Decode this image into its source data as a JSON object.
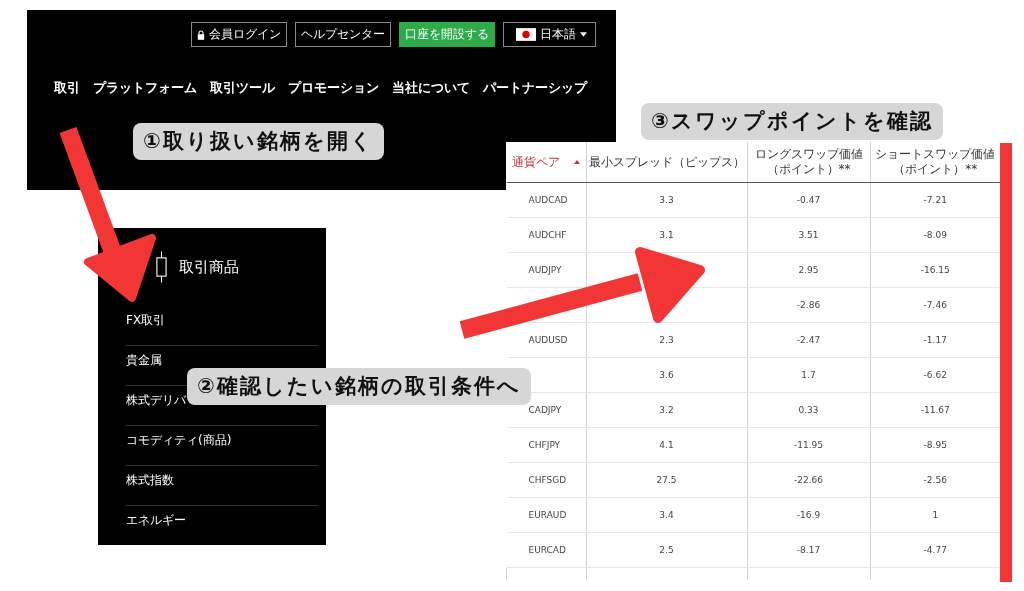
{
  "site": {
    "top_buttons": [
      {
        "kind": "login",
        "label": "会員ログイン"
      },
      {
        "kind": "plain",
        "label": "ヘルプセンター"
      },
      {
        "kind": "primary",
        "label": "口座を開設する"
      },
      {
        "kind": "language",
        "label": "日本語"
      }
    ],
    "menu": [
      "取引",
      "プラットフォーム",
      "取引ツール",
      "プロモーション",
      "当社について",
      "パートナーシップ"
    ]
  },
  "products": {
    "title": "取引商品",
    "items": [
      "FX取引",
      "貴金属",
      "株式デリバ",
      "コモディティ(商品)",
      "株式指数",
      "エネルギー"
    ]
  },
  "table": {
    "columns": [
      {
        "label": "通貨ペア",
        "sorted": true
      },
      {
        "label": "最小スプレッド（ピップス）",
        "sorted": false
      },
      {
        "label": "ロングスワップ価値",
        "note": "（ポイント）**",
        "sorted": false
      },
      {
        "label": "ショートスワップ価値",
        "note": "（ポイント）**",
        "sorted": false
      }
    ],
    "rows": [
      {
        "cells": [
          "AUDCAD",
          "3.3",
          "-0.47",
          "-7.21"
        ]
      },
      {
        "cells": [
          "AUDCHF",
          "3.1",
          "3.51",
          "-8.09"
        ]
      },
      {
        "cells": [
          "AUDJPY",
          null,
          "2.95",
          "-16.15"
        ]
      },
      {
        "cells": [
          null,
          null,
          "-2.86",
          "-7.46"
        ]
      },
      {
        "cells": [
          "AUDUSD",
          "2.3",
          "-2.47",
          "-1.17"
        ]
      },
      {
        "cells": [
          null,
          "3.6",
          "1.7",
          "-6.62"
        ]
      },
      {
        "cells": [
          "CADJPY",
          "3.2",
          "0.33",
          "-11.67"
        ]
      },
      {
        "cells": [
          "CHFJPY",
          "4.1",
          "-11.95",
          "-8.95"
        ]
      },
      {
        "cells": [
          "CHFSGD",
          "27.5",
          "-22.66",
          "-2.56"
        ]
      },
      {
        "cells": [
          "EURAUD",
          "3.4",
          "-16.9",
          "1"
        ]
      },
      {
        "cells": [
          "EURCAD",
          "2.5",
          "-8.17",
          "-4.77"
        ]
      }
    ]
  },
  "captions": [
    "①取り扱い銘柄を開く",
    "②確認したい銘柄の取引条件へ",
    "③スワップポイントを確認"
  ]
}
